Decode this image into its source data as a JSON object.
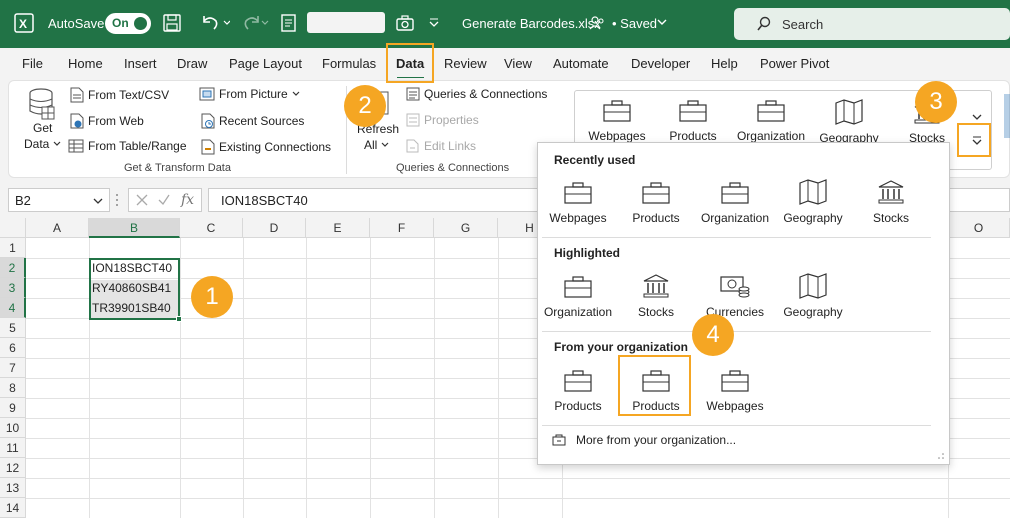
{
  "titlebar": {
    "autosave_label": "AutoSave",
    "autosave_state": "On",
    "doc_title": "Generate Barcodes.xlsx",
    "saved_label": "• Saved",
    "search_placeholder": "Search",
    "brand_color": "#217346"
  },
  "tabs": [
    "File",
    "Home",
    "Insert",
    "Draw",
    "Page Layout",
    "Formulas",
    "Data",
    "Review",
    "View",
    "Automate",
    "Developer",
    "Help",
    "Power Pivot"
  ],
  "active_tab": "Data",
  "ribbon": {
    "get_data": {
      "line1": "Get",
      "line2": "Data"
    },
    "from_text_csv": "From Text/CSV",
    "from_web": "From Web",
    "from_table_range": "From Table/Range",
    "from_picture": "From Picture",
    "recent_sources": "Recent Sources",
    "existing_connections": "Existing Connections",
    "group_get_transform": "Get & Transform Data",
    "refresh": {
      "line1": "Refresh",
      "line2": "All"
    },
    "queries_connections": "Queries & Connections",
    "properties": "Properties",
    "edit_links": "Edit Links",
    "group_queries": "Queries & Connections",
    "gallery": [
      "Webpages",
      "Products",
      "Organization",
      "Geography",
      "Stocks"
    ]
  },
  "formula_bar": {
    "name_box": "B2",
    "fx_symbol": "fx",
    "formula": "ION18SBCT40"
  },
  "grid": {
    "columns": [
      "A",
      "B",
      "C",
      "D",
      "E",
      "F",
      "G",
      "H",
      "O"
    ],
    "rows": [
      "1",
      "2",
      "3",
      "4",
      "5",
      "6",
      "7",
      "8",
      "9",
      "10",
      "11",
      "12",
      "13",
      "14"
    ],
    "cells": {
      "B2": "ION18SBCT40",
      "B3": "RY40860SB41",
      "B4": "TR39901SB40"
    }
  },
  "callouts": [
    "1",
    "2",
    "3",
    "4"
  ],
  "callout_color": "#f5a623",
  "dropdown": {
    "recently_used_title": "Recently used",
    "recently_used": [
      "Webpages",
      "Products",
      "Organization",
      "Geography",
      "Stocks"
    ],
    "highlighted_title": "Highlighted",
    "highlighted": [
      "Organization",
      "Stocks",
      "Currencies",
      "Geography"
    ],
    "org_title": "From your organization",
    "org_items": [
      "Products",
      "Products",
      "Webpages"
    ],
    "more_label": "More from your organization..."
  }
}
